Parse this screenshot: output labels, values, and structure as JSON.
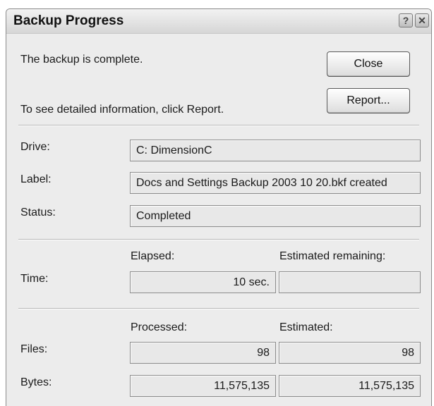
{
  "window": {
    "title": "Backup Progress",
    "help_glyph": "?",
    "close_glyph": "✕"
  },
  "message": {
    "complete": "The backup is complete.",
    "info": "To see detailed information, click Report."
  },
  "buttons": {
    "close": "Close",
    "report": "Report..."
  },
  "details": {
    "drive_label": "Drive:",
    "drive_value": "C: DimensionC",
    "label_label": "Label:",
    "label_value": "Docs and Settings Backup 2003 10 20.bkf created",
    "status_label": "Status:",
    "status_value": "Completed"
  },
  "time": {
    "row_label": "Time:",
    "elapsed_header": "Elapsed:",
    "remaining_header": "Estimated remaining:",
    "elapsed_value": "10 sec.",
    "remaining_value": ""
  },
  "counts": {
    "processed_header": "Processed:",
    "estimated_header": "Estimated:",
    "files_label": "Files:",
    "files_processed": "98",
    "files_estimated": "98",
    "bytes_label": "Bytes:",
    "bytes_processed": "11,575,135",
    "bytes_estimated": "11,575,135"
  }
}
